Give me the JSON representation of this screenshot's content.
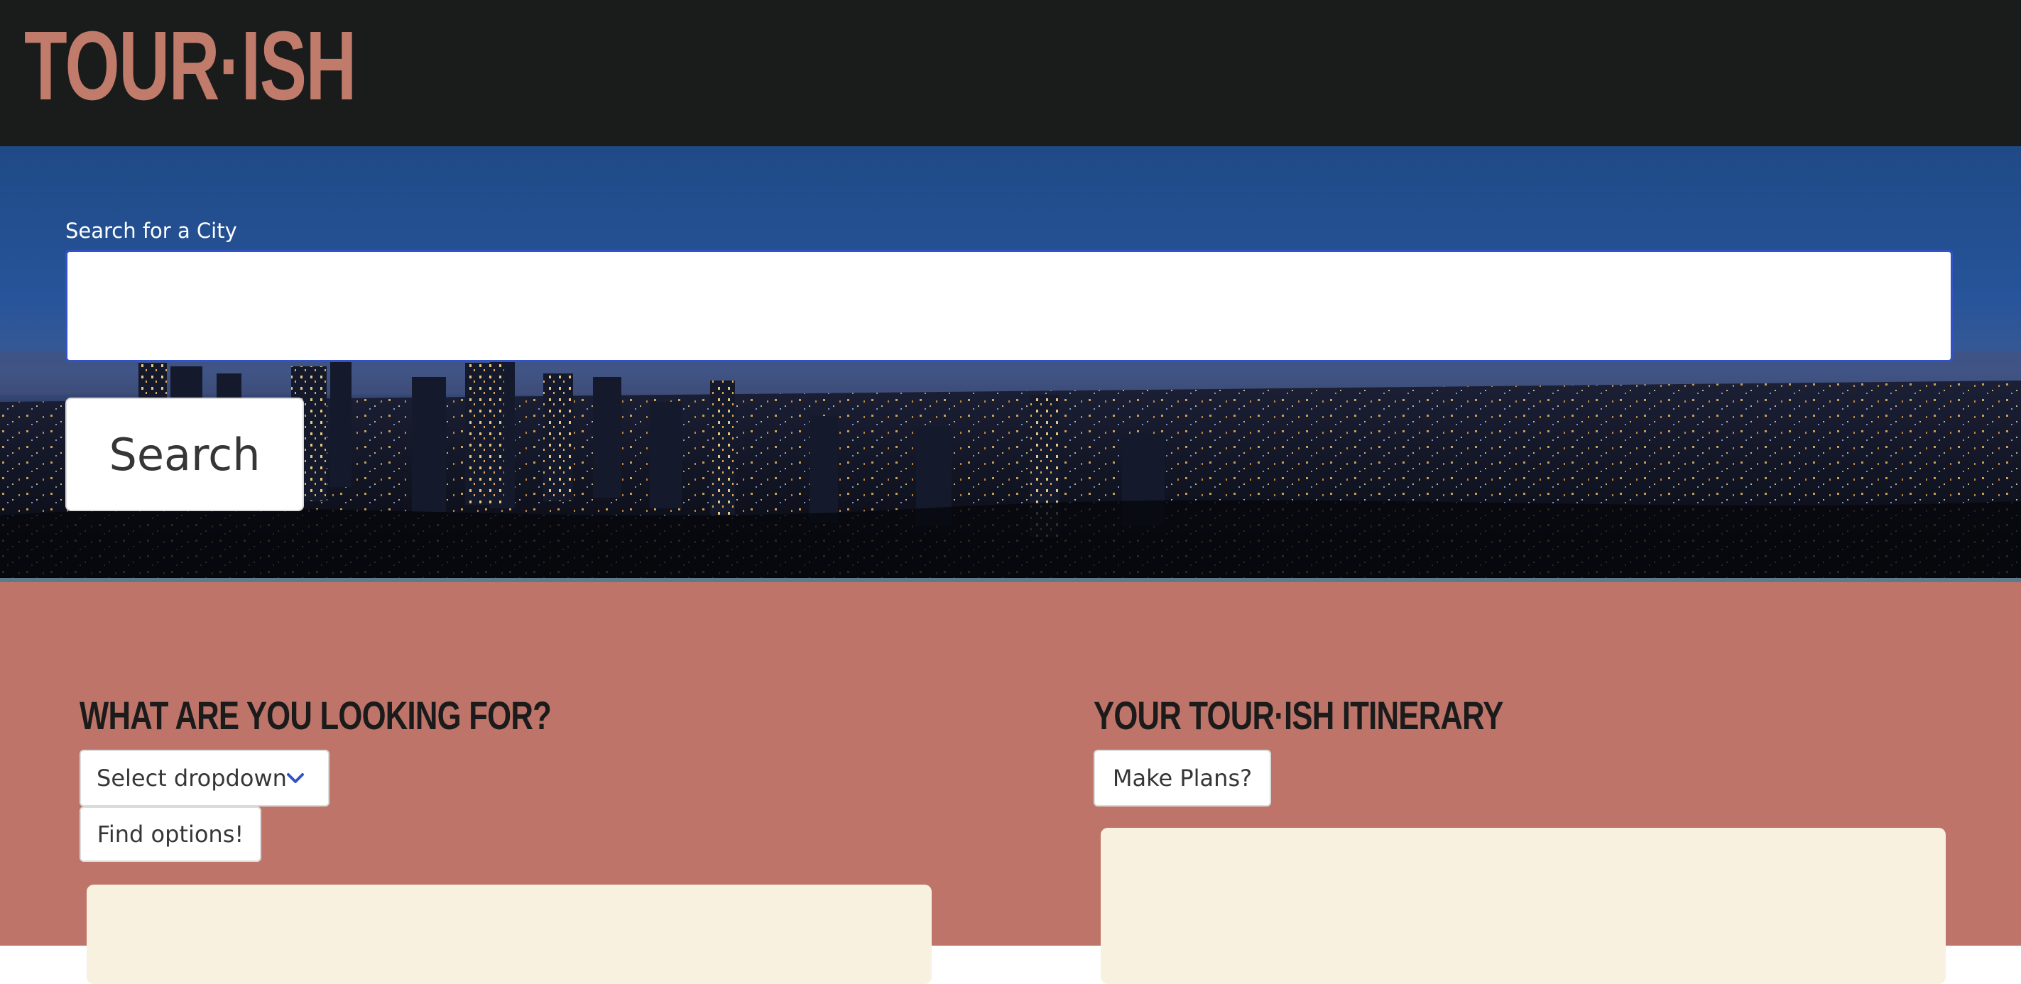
{
  "header": {
    "logo_text": "TOUR·ISH"
  },
  "hero": {
    "search_label": "Search for a City",
    "search_value": "",
    "search_button": "Search"
  },
  "main": {
    "left": {
      "heading": "WHAT ARE YOU LOOKING FOR?",
      "dropdown_selected": "Select dropdown",
      "find_button": "Find options!"
    },
    "right": {
      "heading": "YOUR TOUR·ISH ITINERARY",
      "plans_button": "Make Plans?"
    }
  },
  "colors": {
    "header_bg": "#1a1c1b",
    "logo": "#c07b6b",
    "main_bg": "#be7468",
    "panel_bg": "#f8f1df",
    "input_border": "#3452c8",
    "chevron": "#3452c8"
  },
  "icons": {
    "dropdown": "chevron-down-icon"
  }
}
